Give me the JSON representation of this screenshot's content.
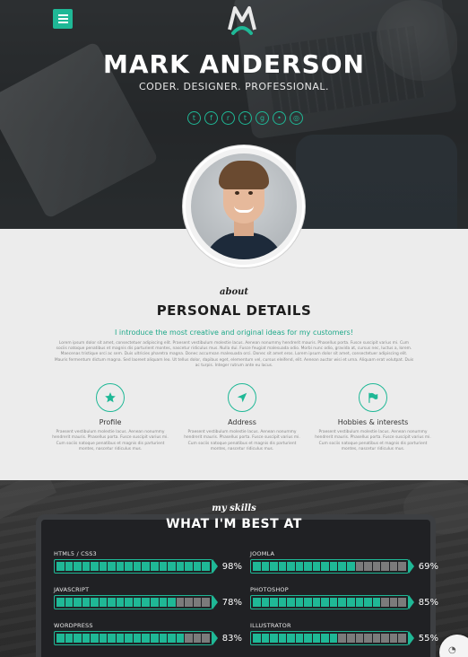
{
  "hero": {
    "logo_text": "M",
    "name": "MARK ANDERSON",
    "tagline": "CODER. DESIGNER. PROFESSIONAL.",
    "social_icons": [
      {
        "icon": "twitter-icon",
        "glyph": "t"
      },
      {
        "icon": "facebook-icon",
        "glyph": "f"
      },
      {
        "icon": "rss-icon",
        "glyph": "r"
      },
      {
        "icon": "tumblr-icon",
        "glyph": "t"
      },
      {
        "icon": "google-plus-icon",
        "glyph": "g"
      },
      {
        "icon": "flickr-icon",
        "glyph": "•"
      },
      {
        "icon": "dribbble-icon",
        "glyph": "◎"
      }
    ]
  },
  "about": {
    "script_label": "about",
    "title": "PERSONAL DETAILS",
    "intro": "I introduce the most creative and original ideas for my customers!",
    "body": "Lorem ipsum dolor sit amet, consectetuer adipiscing elit. Praesent vestibulum molestie lacus. Aenean nonummy hendrerit mauris. Phasellus porta. Fusce suscipit varius mi. Cum sociis natoque penatibus et magnis dis parturient montes, nascetur ridiculus mus. Nulla dui. Fusce feugiat malesuada odio. Morbi nunc odio, gravida at, cursus nec, luctus a, lorem. Maecenas tristique orci ac sem. Duis ultricies pharetra magna. Donec accumsan malesuada orci. Donec sit amet eros. Lorem ipsum dolor sit amet, consectetuer adipiscing elit. Mauris fermentum dictum magna. Sed laoreet aliquam leo. Ut tellus dolor, dapibus eget, elementum vel, cursus eleifend, elit. Aenean auctor wisi et urna. Aliquam erat volutpat. Duis ac turpis. Integer rutrum ante eu lacus.",
    "features": [
      {
        "icon": "star-icon",
        "label": "Profile",
        "text": "Praesent vestibulum molestie lacus. Aenean nonummy hendrerit mauris. Phasellus porta. Fusce suscipit varius mi. Cum sociis natoque penatibus et magnis dis parturient montes, nascetur ridiculus mus."
      },
      {
        "icon": "location-arrow-icon",
        "label": "Address",
        "text": "Praesent vestibulum molestie lacus. Aenean nonummy hendrerit mauris. Phasellus porta. Fusce suscipit varius mi. Cum sociis natoque penatibus et magnis dis parturient montes, nascetur ridiculus mus."
      },
      {
        "icon": "flag-icon",
        "label": "Hobbies & interests",
        "text": "Praesent vestibulum molestie lacus. Aenean nonummy hendrerit mauris. Phasellus porta. Fusce suscipit varius mi. Cum sociis natoque penatibus et magnis dis parturient montes, nascetur ridiculus mus."
      }
    ]
  },
  "skills": {
    "script_label": "my skills",
    "title": "WHAT I'M BEST AT",
    "items": [
      {
        "name": "HTML5 / CSS3",
        "percent": "98%",
        "level": 0.98
      },
      {
        "name": "JOOMLA",
        "percent": "69%",
        "level": 0.69
      },
      {
        "name": "JAVASCRIPT",
        "percent": "78%",
        "level": 0.78
      },
      {
        "name": "PHOTOSHOP",
        "percent": "85%",
        "level": 0.85
      },
      {
        "name": "WORDPRESS",
        "percent": "83%",
        "level": 0.83
      },
      {
        "name": "ILLUSTRATOR",
        "percent": "55%",
        "level": 0.55
      }
    ]
  },
  "colors": {
    "accent": "#1fb896",
    "hero_bg": "#2d3033",
    "section_bg": "#ececec",
    "skills_bg": "#2c2c2c"
  }
}
